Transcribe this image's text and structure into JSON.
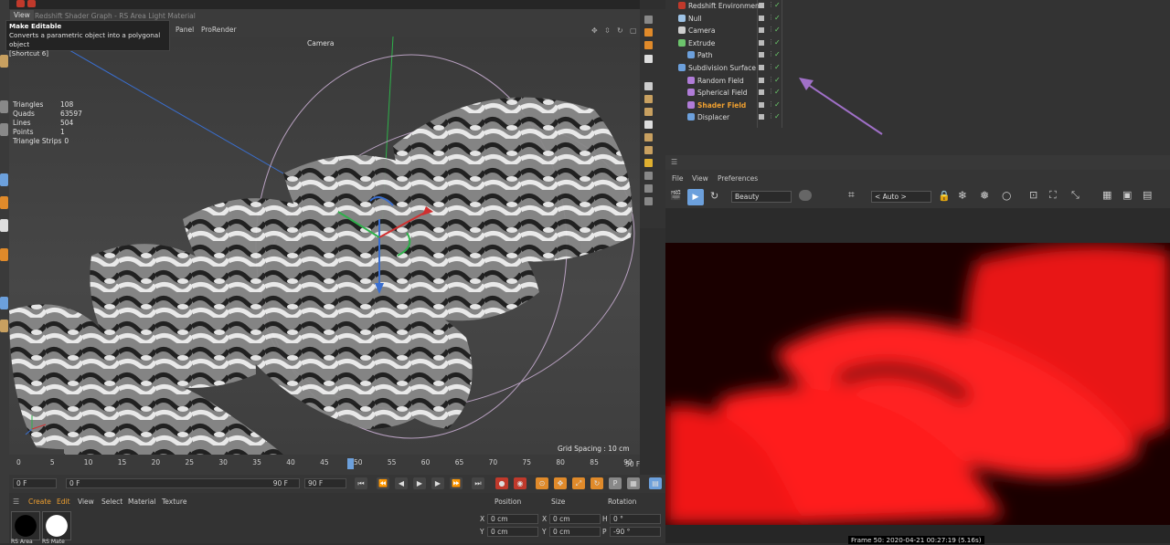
{
  "window": {
    "title": "Redshift Shader Graph - RS Area Light Material"
  },
  "viewport": {
    "view_tab": "View",
    "menus": [
      "Panel",
      "ProRender"
    ],
    "camera_label": "Camera",
    "grid_spacing": "Grid Spacing : 10 cm",
    "stats": [
      {
        "label": "Triangles",
        "value": "108"
      },
      {
        "label": "Quads",
        "value": "63597"
      },
      {
        "label": "Lines",
        "value": "504"
      },
      {
        "label": "Points",
        "value": "1"
      },
      {
        "label": "Triangle Strips",
        "value": "0"
      }
    ]
  },
  "tooltip": {
    "title": "Make Editable",
    "desc": "Converts a parametric object into a polygonal object",
    "shortcut": "[Shortcut 6]"
  },
  "objects": [
    {
      "name": "Redshift Environment",
      "icon_color": "#c0392b",
      "indent": 0
    },
    {
      "name": "Null",
      "icon_color": "#9ec3e6",
      "indent": 0
    },
    {
      "name": "Camera",
      "icon_color": "#cfcfcf",
      "indent": 0
    },
    {
      "name": "Extrude",
      "icon_color": "#6cc46c",
      "indent": 0
    },
    {
      "name": "Path",
      "icon_color": "#6ca0dc",
      "indent": 1
    },
    {
      "name": "Subdivision Surface",
      "icon_color": "#6ca0dc",
      "indent": 0
    },
    {
      "name": "Random Field",
      "icon_color": "#b07cd8",
      "indent": 1
    },
    {
      "name": "Spherical Field",
      "icon_color": "#b07cd8",
      "indent": 1
    },
    {
      "name": "Shader Field",
      "icon_color": "#b07cd8",
      "indent": 1,
      "selected": true
    },
    {
      "name": "Displacer",
      "icon_color": "#6ca0dc",
      "indent": 1
    }
  ],
  "render_view": {
    "menus": [
      "File",
      "View",
      "Preferences"
    ],
    "aov_select": "Beauty",
    "camera_select": "< Auto >",
    "frame_info": "Frame  50:  2020-04-21  00:27:19  (5.16s)"
  },
  "timeline": {
    "ticks": [
      "0",
      "5",
      "10",
      "15",
      "20",
      "25",
      "30",
      "35",
      "40",
      "45",
      "50",
      "55",
      "60",
      "65",
      "70",
      "75",
      "80",
      "85",
      "90"
    ],
    "end_label": "50 F",
    "current_frame": "0 F",
    "start_field": "0 F",
    "end_field": "90 F",
    "max_field": "90 F"
  },
  "material_manager": {
    "menus": [
      "Create",
      "Edit",
      "View",
      "Select",
      "Material",
      "Texture"
    ],
    "materials": [
      "RS Area",
      "RS Mate"
    ]
  },
  "coordinates": {
    "headers": [
      "Position",
      "Size",
      "Rotation"
    ],
    "rows": [
      {
        "axis": "X",
        "pos": "0 cm",
        "size_axis": "X",
        "size": "0 cm",
        "rot_axis": "H",
        "rot": "0 °"
      },
      {
        "axis": "Y",
        "pos": "0 cm",
        "size_axis": "Y",
        "size": "0 cm",
        "rot_axis": "P",
        "rot": "-90 °"
      }
    ]
  },
  "colors": {
    "accent": "#6ca0dc",
    "render_red": "#ff1a1a",
    "arrow": "#a070c8"
  }
}
